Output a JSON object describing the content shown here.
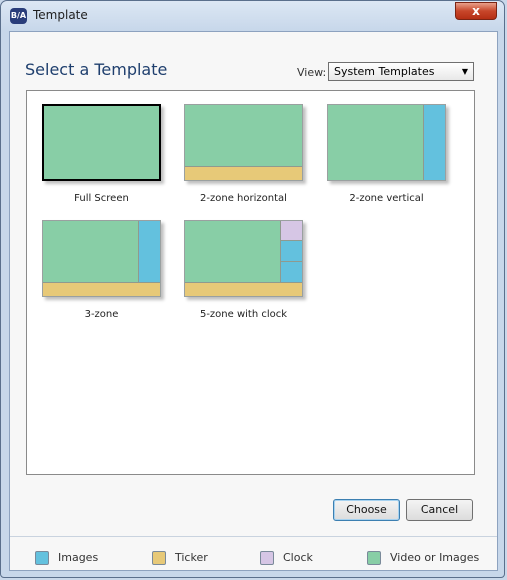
{
  "window": {
    "title": "Template",
    "app_icon_text": "B/A",
    "close_label": "x"
  },
  "header": {
    "title": "Select a Template",
    "view_label": "View:",
    "view_selected": "System Templates"
  },
  "templates": [
    {
      "label": "Full Screen",
      "selected": true
    },
    {
      "label": "2-zone horizontal",
      "selected": false
    },
    {
      "label": "2-zone vertical",
      "selected": false
    },
    {
      "label": "3-zone",
      "selected": false
    },
    {
      "label": "5-zone with clock",
      "selected": false
    }
  ],
  "buttons": {
    "choose": "Choose",
    "cancel": "Cancel"
  },
  "legend": [
    {
      "label": "Images",
      "color": "#63c1de"
    },
    {
      "label": "Ticker",
      "color": "#e7c978"
    },
    {
      "label": "Clock",
      "color": "#d6c6e5"
    },
    {
      "label": "Video or Images",
      "color": "#88cea6"
    }
  ]
}
